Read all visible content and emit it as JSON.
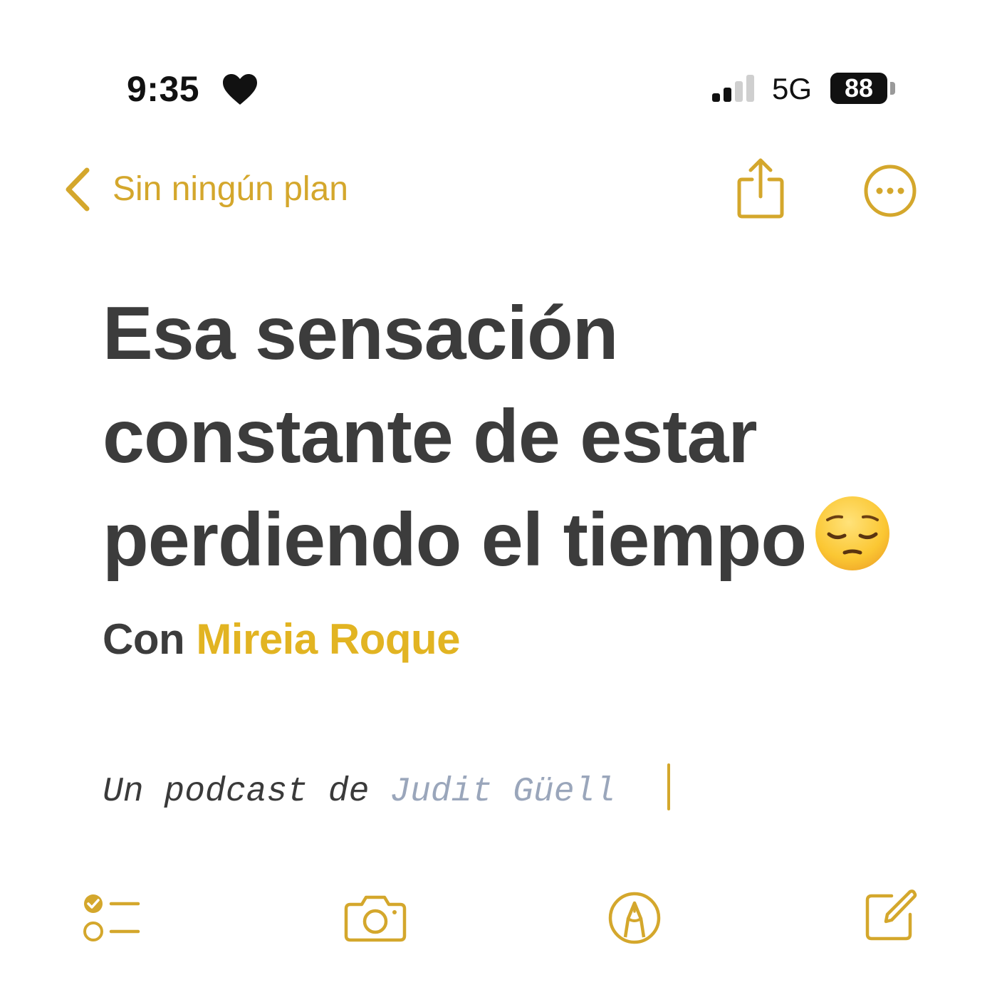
{
  "status_bar": {
    "time": "9:35",
    "focus_icon": "heart-icon",
    "signal_icon": "cellular-signal-icon",
    "signal_bars_active": 2,
    "signal_bars_total": 4,
    "network": "5G",
    "battery_percent": "88",
    "battery_level": 0.88
  },
  "nav": {
    "back_label": "Sin ningún plan",
    "back_icon": "chevron-left-icon",
    "share_icon": "share-icon",
    "more_icon": "ellipsis-circle-icon"
  },
  "note": {
    "title_lines": [
      "Esa sensación",
      "constante de estar",
      "perdiendo el tiempo"
    ],
    "title_emoji": "pensive-face-emoji",
    "subtitle_prefix": "Con",
    "subtitle_name": "Mireia Roque",
    "mono_prefix": "Un podcast de",
    "mono_name": "Judit Güell"
  },
  "toolbar": {
    "checklist_icon": "checklist-icon",
    "camera_icon": "camera-icon",
    "markup_icon": "markup-pen-icon",
    "compose_icon": "compose-icon"
  },
  "colors": {
    "accent": "#d4a72c",
    "name_highlight": "#e2b422",
    "title_text": "#3c3c3c",
    "mono_name": "#9aa6bb",
    "background": "#ffffff"
  }
}
